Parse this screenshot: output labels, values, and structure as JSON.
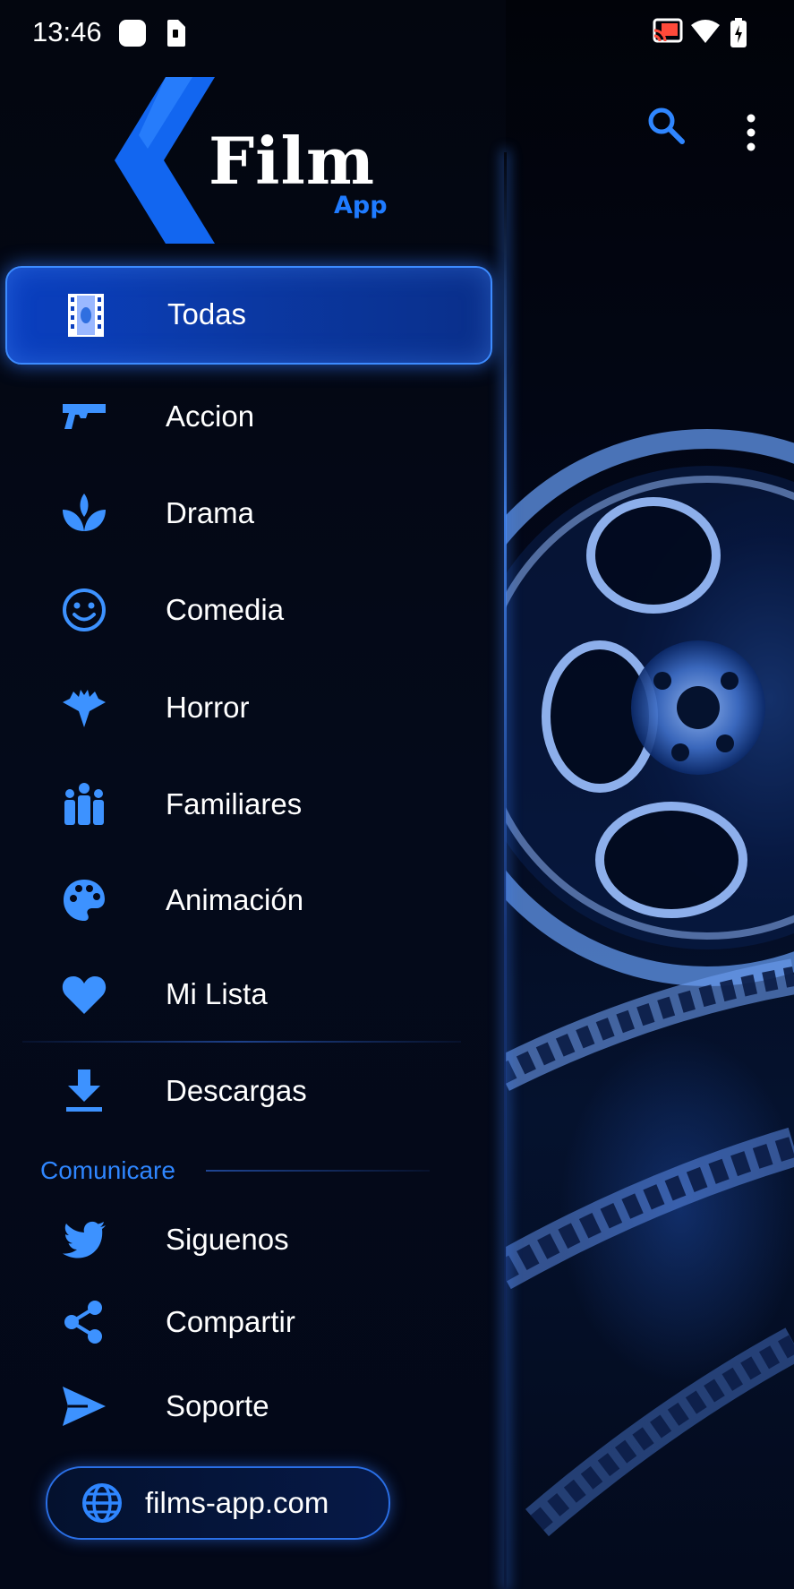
{
  "status_bar": {
    "time": "13:46",
    "icons": [
      "notification-square-icon",
      "sim-lock-icon",
      "cast-icon",
      "wifi-icon",
      "battery-icon"
    ]
  },
  "app": {
    "logo_title": "Film",
    "logo_subtitle": "App"
  },
  "toolbar": {
    "icons": [
      "search-icon",
      "more-vert-icon"
    ]
  },
  "drawer": {
    "categories": [
      {
        "label": "Todas",
        "icon": "film-strip-icon",
        "selected": true
      },
      {
        "label": "Accion",
        "icon": "pistol-icon"
      },
      {
        "label": "Drama",
        "icon": "lotus-icon"
      },
      {
        "label": "Comedia",
        "icon": "smiley-icon"
      },
      {
        "label": "Horror",
        "icon": "bat-icon"
      },
      {
        "label": "Familiares",
        "icon": "family-icon"
      },
      {
        "label": "Animación",
        "icon": "palette-icon"
      },
      {
        "label": "Mi Lista",
        "icon": "heart-icon"
      }
    ],
    "downloads": {
      "label": "Descargas",
      "icon": "download-icon"
    },
    "section_title": "Comunicare",
    "social": [
      {
        "label": "Siguenos",
        "icon": "twitter-icon"
      },
      {
        "label": "Compartir",
        "icon": "share-icon"
      },
      {
        "label": "Soporte",
        "icon": "send-icon"
      }
    ],
    "website": {
      "label": "films-app.com",
      "icon": "globe-icon"
    }
  },
  "colors": {
    "accent": "#1f7bff",
    "icon_blue": "#3d92ff",
    "background": "#020611",
    "active_item": "#0a3fc0"
  }
}
